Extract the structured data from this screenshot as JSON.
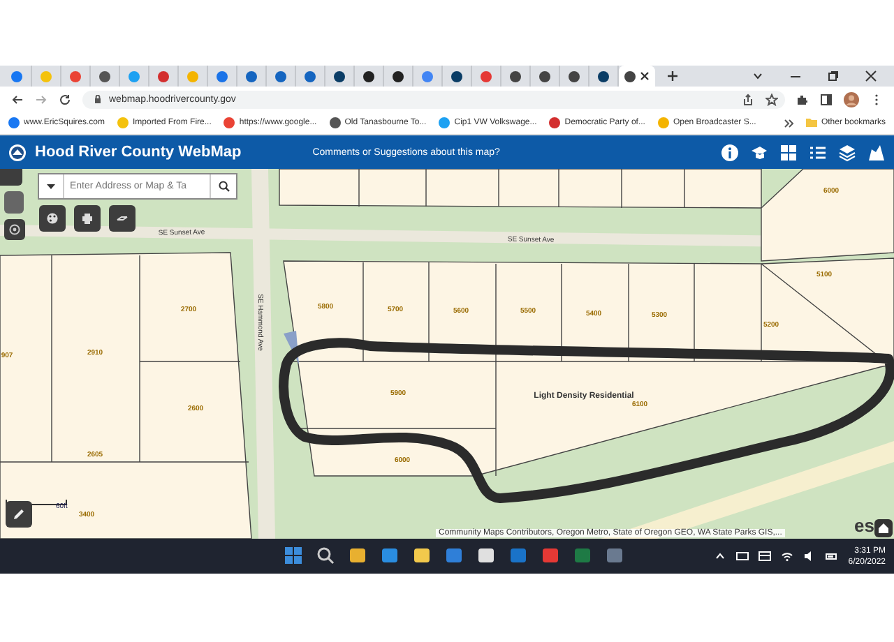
{
  "browser": {
    "tabs": [
      {
        "selected": false
      },
      {
        "selected": false
      },
      {
        "selected": false
      },
      {
        "selected": false
      },
      {
        "selected": false
      },
      {
        "selected": false
      },
      {
        "selected": false
      },
      {
        "selected": false
      },
      {
        "selected": false
      },
      {
        "selected": false
      },
      {
        "selected": false
      },
      {
        "selected": false
      },
      {
        "selected": false
      },
      {
        "selected": false
      },
      {
        "selected": false
      },
      {
        "selected": false
      },
      {
        "selected": false
      },
      {
        "selected": false
      },
      {
        "selected": false
      },
      {
        "selected": false
      },
      {
        "selected": false
      },
      {
        "selected": true
      }
    ],
    "address": "webmap.hoodrivercounty.gov",
    "bookmarks": [
      "www.EricSquires.com",
      "Imported From Fire...",
      "https://www.google...",
      "Old Tanasbourne To...",
      "Cip1 VW Volkswage...",
      "Democratic Party of...",
      "Open Broadcaster S..."
    ],
    "other_bookmarks": "Other bookmarks"
  },
  "app": {
    "title": "Hood River County WebMap",
    "feedback_link": "Comments or Suggestions about this map?",
    "search": {
      "placeholder": "Enter Address or Map & Ta"
    }
  },
  "map": {
    "streets": [
      "SE Sunset Ave",
      "SE Sunset Ave",
      "SE Hammond Ave"
    ],
    "parcels": [
      "6000",
      "5800",
      "5700",
      "5600",
      "5500",
      "5400",
      "5300",
      "5100",
      "5200",
      "907",
      "2910",
      "2700",
      "2600",
      "2605",
      "3400",
      "5900",
      "6100",
      "6000"
    ],
    "zone": "Light Density Residential",
    "scale": "60ft",
    "attribution": "Community Maps Contributors, Oregon Metro, State of Oregon GEO, WA State Parks GIS,...",
    "logo": "es"
  },
  "taskbar": {
    "time": "3:31 PM",
    "date": "6/20/2022"
  }
}
